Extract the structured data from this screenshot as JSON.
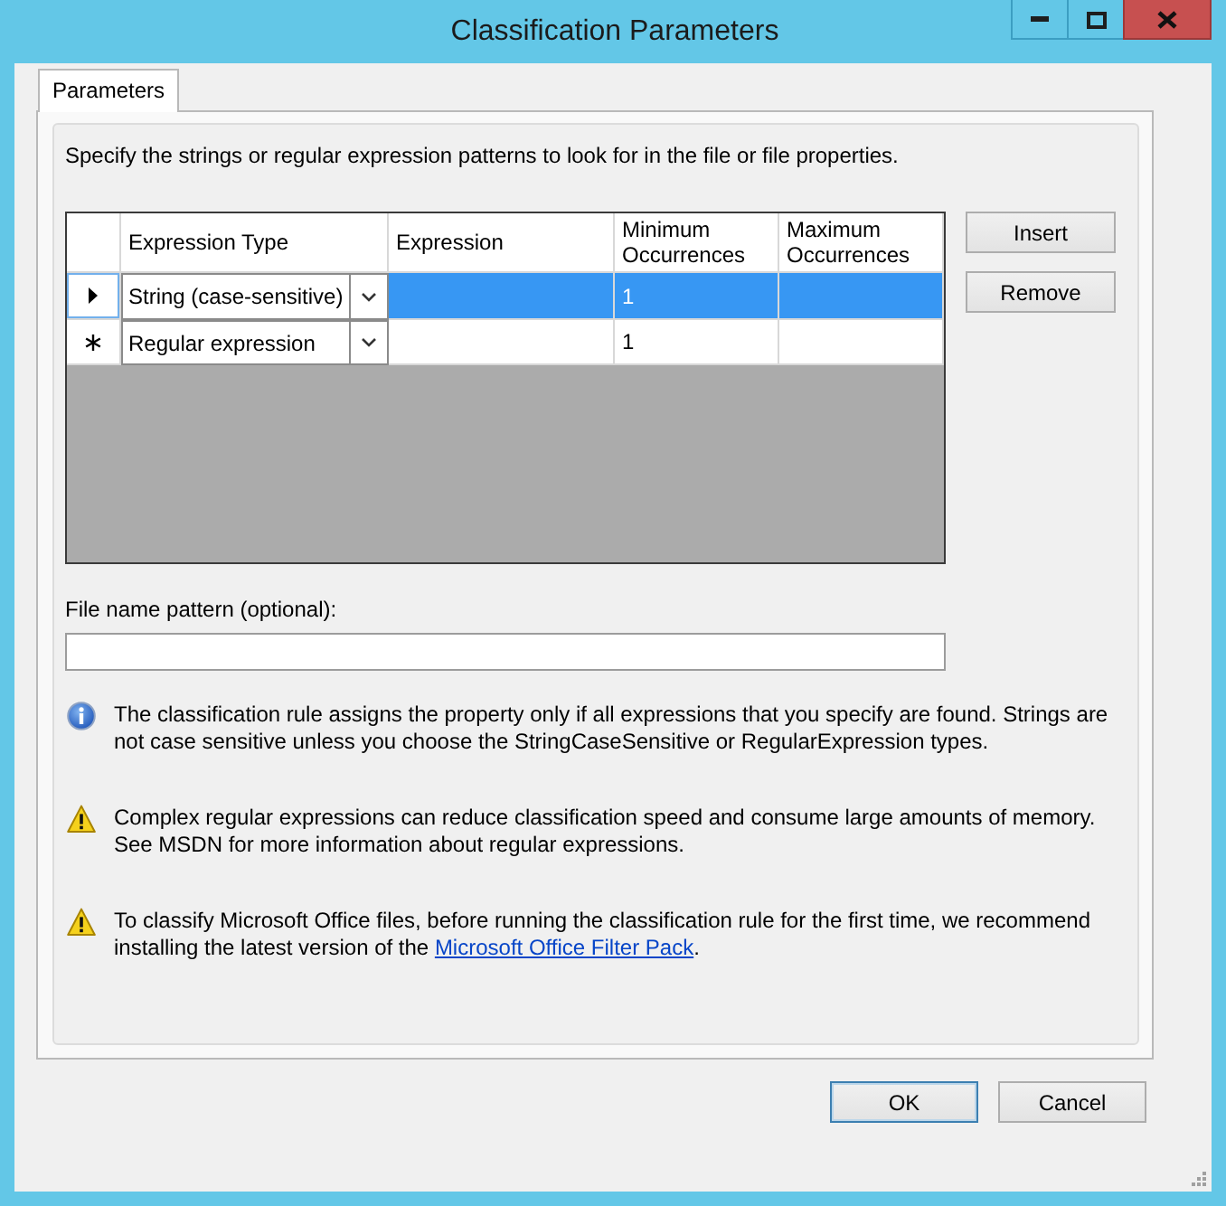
{
  "window": {
    "title": "Classification Parameters"
  },
  "tabs": [
    {
      "label": "Parameters",
      "selected": true
    }
  ],
  "description": "Specify the strings or regular expression patterns to look for in the file or file properties.",
  "grid": {
    "columns": [
      "Expression Type",
      "Expression",
      "Minimum Occurrences",
      "Maximum Occurrences"
    ],
    "rows": [
      {
        "kind": "current",
        "selected": true,
        "type": "String (case-sensitive)",
        "minimum": "1"
      },
      {
        "kind": "new",
        "selected": false,
        "type": "Regular expression",
        "minimum": "1"
      }
    ]
  },
  "grid_buttons": [
    "Insert",
    "Remove"
  ],
  "file_name_pattern": {
    "label": "File name pattern (optional):"
  },
  "notes": [
    {
      "kind": "info",
      "text": "The classification rule assigns the property only if all expressions that you specify are found. Strings are not case sensitive unless you choose the StringCaseSensitive or RegularExpression types."
    },
    {
      "kind": "warning",
      "text": "Complex regular expressions can reduce classification speed and consume large amounts of memory. See MSDN for more information about regular expressions."
    },
    {
      "kind": "warning",
      "text": "To classify Microsoft Office files, before running the classification rule for the first time, we recommend installing the latest version of the ",
      "link": "Microsoft Office Filter Pack",
      "text_after": "."
    }
  ],
  "dialog_buttons": [
    {
      "label": "OK",
      "default": true
    },
    {
      "label": "Cancel",
      "default": false
    }
  ]
}
